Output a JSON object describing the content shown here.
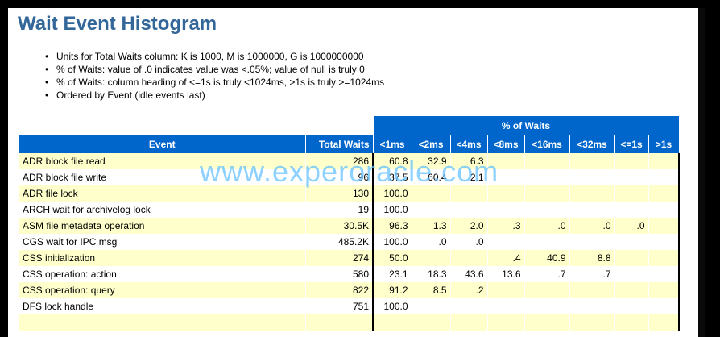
{
  "title": "Wait Event Histogram",
  "notes": [
    "Units for Total Waits column: K is 1000, M is 1000000, G is 1000000000",
    "% of Waits: value of .0 indicates value was <.05%; value of null is truly 0",
    "% of Waits: column heading of <=1s is truly <1024ms, >1s is truly >=1024ms",
    "Ordered by Event (idle events last)"
  ],
  "table": {
    "group_header": "% of Waits",
    "headers": [
      "Event",
      "Total Waits",
      "<1ms",
      "<2ms",
      "<4ms",
      "<8ms",
      "<16ms",
      "<32ms",
      "<=1s",
      ">1s"
    ],
    "rows": [
      [
        "ADR block file read",
        "286",
        "60.8",
        "32.9",
        "6.3",
        "",
        "",
        "",
        "",
        ""
      ],
      [
        "ADR block file write",
        "96",
        "37.5",
        "60.4",
        "2.1",
        "",
        "",
        "",
        "",
        ""
      ],
      [
        "ADR file lock",
        "130",
        "100.0",
        "",
        "",
        "",
        "",
        "",
        "",
        ""
      ],
      [
        "ARCH wait for archivelog lock",
        "19",
        "100.0",
        "",
        "",
        "",
        "",
        "",
        "",
        ""
      ],
      [
        "ASM file metadata operation",
        "30.5K",
        "96.3",
        "1.3",
        "2.0",
        ".3",
        ".0",
        ".0",
        ".0",
        ""
      ],
      [
        "CGS wait for IPC msg",
        "485.2K",
        "100.0",
        ".0",
        ".0",
        "",
        "",
        "",
        "",
        ""
      ],
      [
        "CSS initialization",
        "274",
        "50.0",
        "",
        "",
        ".4",
        "40.9",
        "8.8",
        "",
        ""
      ],
      [
        "CSS operation: action",
        "580",
        "23.1",
        "18.3",
        "43.6",
        "13.6",
        ".7",
        ".7",
        "",
        ""
      ],
      [
        "CSS operation: query",
        "822",
        "91.2",
        "8.5",
        ".2",
        "",
        "",
        "",
        "",
        ""
      ],
      [
        "DFS lock handle",
        "751",
        "100.0",
        "",
        "",
        "",
        "",
        "",
        "",
        ""
      ],
      [
        "",
        "",
        "",
        "",
        "",
        "",
        "",
        "",
        "",
        ""
      ]
    ]
  },
  "watermark": "www.experoracle.com"
}
